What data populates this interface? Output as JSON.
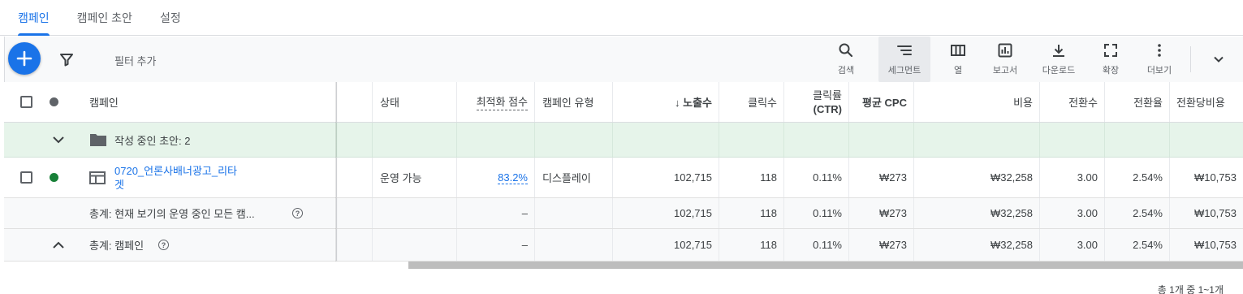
{
  "tabs": [
    {
      "label": "캠페인",
      "active": true
    },
    {
      "label": "캠페인 초안",
      "active": false
    },
    {
      "label": "설정",
      "active": false
    }
  ],
  "toolbar": {
    "filter_label": "필터 추가",
    "tools": [
      {
        "label": "검색",
        "icon": "search-icon"
      },
      {
        "label": "세그먼트",
        "icon": "segment-icon"
      },
      {
        "label": "열",
        "icon": "columns-icon"
      },
      {
        "label": "보고서",
        "icon": "reports-icon"
      },
      {
        "label": "다운로드",
        "icon": "download-icon"
      },
      {
        "label": "확장",
        "icon": "expand-icon"
      },
      {
        "label": "더보기",
        "icon": "more-vert-icon"
      }
    ]
  },
  "table": {
    "headers": {
      "campaign": "캠페인",
      "status": "상태",
      "score": "최적화 점수",
      "type": "캠페인 유형",
      "impressions": "↓ 노출수",
      "clicks": "클릭수",
      "ctr_line1": "클릭률",
      "ctr_line2": "(CTR)",
      "avg_cpc": "평균 CPC",
      "cost": "비용",
      "conversions": "전환수",
      "conv_rate": "전환율",
      "cost_per_conv": "전환당비용"
    },
    "draft_row": {
      "label": "작성 중인 초안: 2"
    },
    "rows": [
      {
        "name_line1": "0720_언론사배너광고_리타",
        "name_line2": "겟",
        "status": "운영 가능",
        "score": "83.2%",
        "type": "디스플레이",
        "impressions": "102,715",
        "clicks": "118",
        "ctr": "0.11%",
        "avg_cpc": "₩273",
        "cost": "₩32,258",
        "conversions": "3.00",
        "conv_rate": "2.54%",
        "cost_per_conv": "₩10,753"
      }
    ],
    "totals": [
      {
        "label": "총계: 현재 보기의 운영 중인 모든 캠...",
        "score": "–",
        "impressions": "102,715",
        "clicks": "118",
        "ctr": "0.11%",
        "avg_cpc": "₩273",
        "cost": "₩32,258",
        "conversions": "3.00",
        "conv_rate": "2.54%",
        "cost_per_conv": "₩10,753"
      },
      {
        "label": "총계: 캠페인",
        "score": "–",
        "impressions": "102,715",
        "clicks": "118",
        "ctr": "0.11%",
        "avg_cpc": "₩273",
        "cost": "₩32,258",
        "conversions": "3.00",
        "conv_rate": "2.54%",
        "cost_per_conv": "₩10,753"
      }
    ]
  },
  "footer": {
    "pagination": "총 1개 중 1~1개"
  },
  "colors": {
    "accent": "#1a73e8",
    "enabled_dot": "#188038",
    "draft_bg": "#e6f4ea"
  }
}
